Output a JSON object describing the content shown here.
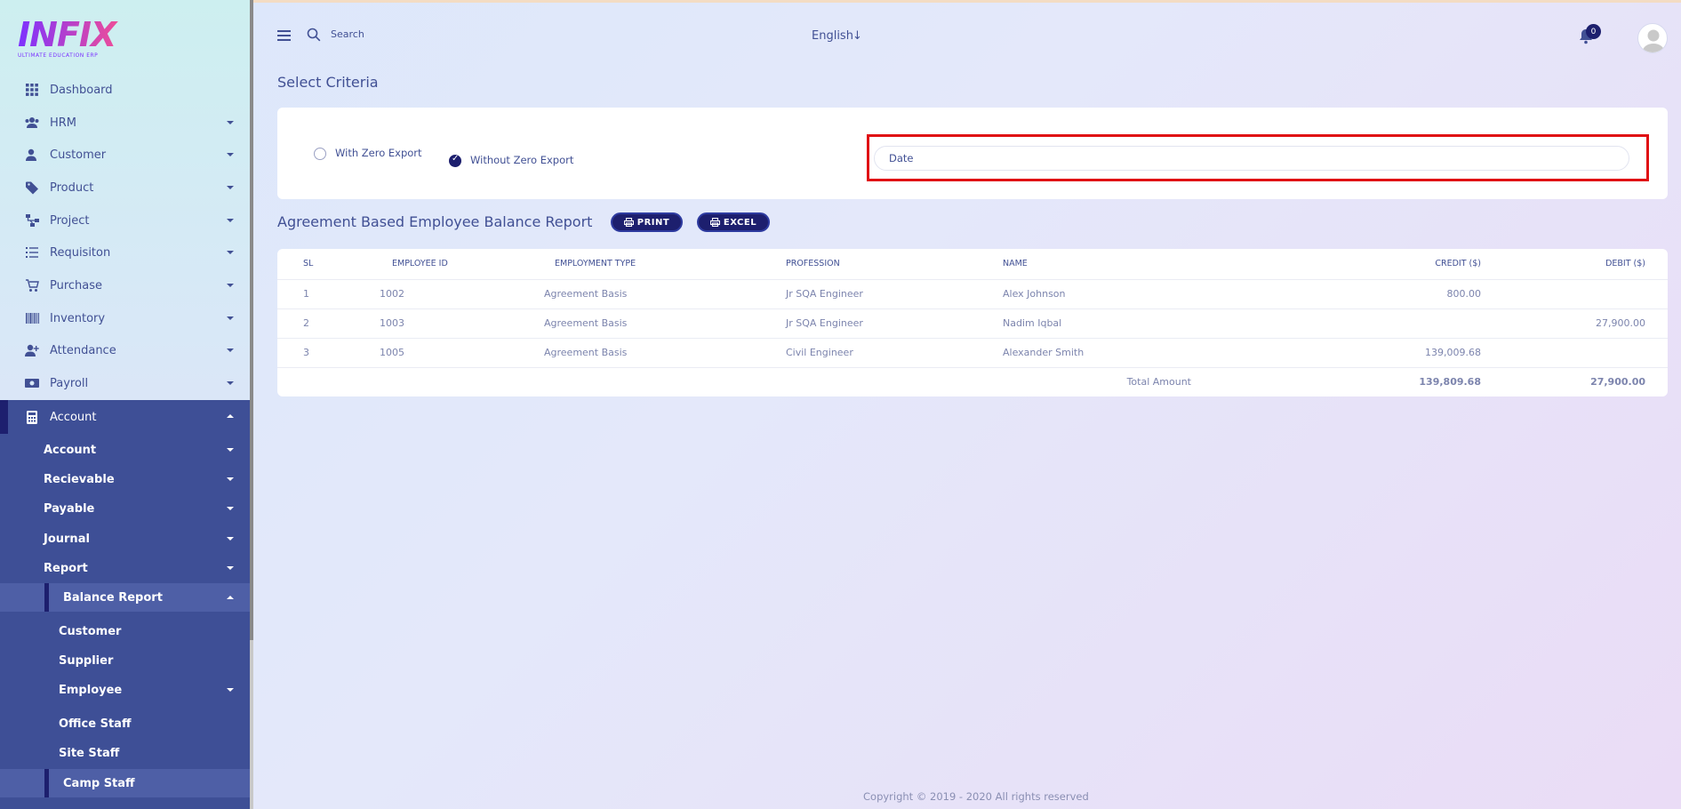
{
  "app": {
    "logo_text": "INFIX",
    "logo_tagline": "ULTIMATE EDUCATION ERP"
  },
  "sidebar": {
    "items": [
      {
        "label": "Dashboard",
        "icon": "grid-icon"
      },
      {
        "label": "HRM",
        "icon": "users-icon"
      },
      {
        "label": "Customer",
        "icon": "user-icon"
      },
      {
        "label": "Product",
        "icon": "tag-icon"
      },
      {
        "label": "Project",
        "icon": "sitemap-icon"
      },
      {
        "label": "Requisiton",
        "icon": "list-icon"
      },
      {
        "label": "Purchase",
        "icon": "cart-icon"
      },
      {
        "label": "Inventory",
        "icon": "barcode-icon"
      },
      {
        "label": "Attendance",
        "icon": "user-plus-icon"
      },
      {
        "label": "Payroll",
        "icon": "money-icon"
      }
    ],
    "account": {
      "label": "Account",
      "icon": "calculator-icon",
      "sub_items": [
        {
          "label": "Account"
        },
        {
          "label": "Recievable"
        },
        {
          "label": "Payable"
        },
        {
          "label": "Journal"
        },
        {
          "label": "Report"
        }
      ],
      "balance_report": {
        "label": "Balance Report",
        "children": [
          {
            "label": "Customer"
          },
          {
            "label": "Supplier"
          },
          {
            "label": "Employee"
          }
        ],
        "employee_children": [
          {
            "label": "Office Staff"
          },
          {
            "label": "Site Staff"
          },
          {
            "label": "Camp Staff"
          }
        ]
      }
    }
  },
  "header": {
    "search_label": "Search",
    "language": "English",
    "notification_count": "0"
  },
  "criteria": {
    "title": "Select Criteria",
    "option_zero": "With Zero Export",
    "option_without_zero": "Without Zero Export",
    "selected": "without_zero",
    "date_placeholder": "Date"
  },
  "report": {
    "title": "Agreement Based Employee Balance Report",
    "print_label": "PRINT",
    "excel_label": "EXCEL",
    "columns": [
      "SL",
      "EMPLOYEE ID",
      "EMPLOYMENT TYPE",
      "PROFESSION",
      "NAME",
      "CREDIT ($)",
      "DEBIT ($)"
    ],
    "rows": [
      {
        "sl": "1",
        "employee_id": "1002",
        "type": "Agreement Basis",
        "profession": "Jr SQA Engineer",
        "name": "Alex Johnson",
        "credit": "800.00",
        "debit": ""
      },
      {
        "sl": "2",
        "employee_id": "1003",
        "type": "Agreement Basis",
        "profession": "Jr SQA Engineer",
        "name": "Nadim Iqbal",
        "credit": "",
        "debit": "27,900.00"
      },
      {
        "sl": "3",
        "employee_id": "1005",
        "type": "Agreement Basis",
        "profession": "Civil Engineer",
        "name": "Alexander Smith",
        "credit": "139,009.68",
        "debit": ""
      }
    ],
    "total_label": "Total Amount",
    "total_credit": "139,809.68",
    "total_debit": "27,900.00"
  },
  "footer": {
    "copyright": "Copyright © 2019 - 2020 All rights reserved"
  },
  "colors": {
    "primary": "#1d1f6e",
    "text": "#415094",
    "sidebar_active": "#3e4f96",
    "highlight": "#e00f14"
  }
}
